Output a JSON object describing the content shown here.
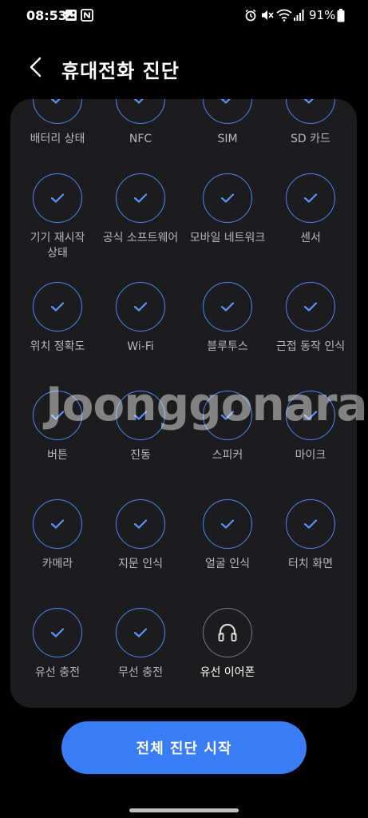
{
  "status_bar": {
    "time": "08:53",
    "battery": "91%",
    "icons": [
      "gallery-icon",
      "nfc-icon",
      "alarm-icon",
      "mute-icon",
      "wifi-icon",
      "signal-icon",
      "battery-icon"
    ]
  },
  "header": {
    "title": "휴대전화 진단",
    "back_icon": "chevron-left-icon"
  },
  "tests": [
    {
      "label": "배터리 상태",
      "status": "passed"
    },
    {
      "label": "NFC",
      "status": "passed"
    },
    {
      "label": "SIM",
      "status": "passed"
    },
    {
      "label": "SD 카드",
      "status": "passed"
    },
    {
      "label": "기기 재시작\n상태",
      "status": "passed"
    },
    {
      "label": "공식 소프트웨어",
      "status": "passed"
    },
    {
      "label": "모바일 네트워크",
      "status": "passed"
    },
    {
      "label": "센서",
      "status": "passed"
    },
    {
      "label": "위치 정확도",
      "status": "passed"
    },
    {
      "label": "Wi-Fi",
      "status": "passed"
    },
    {
      "label": "블루투스",
      "status": "passed"
    },
    {
      "label": "근접 동작 인식",
      "status": "passed"
    },
    {
      "label": "버튼",
      "status": "passed"
    },
    {
      "label": "진동",
      "status": "passed"
    },
    {
      "label": "스피커",
      "status": "passed"
    },
    {
      "label": "마이크",
      "status": "passed"
    },
    {
      "label": "카메라",
      "status": "passed"
    },
    {
      "label": "지문 인식",
      "status": "passed"
    },
    {
      "label": "얼굴 인식",
      "status": "passed"
    },
    {
      "label": "터치 화면",
      "status": "passed"
    },
    {
      "label": "유선 충전",
      "status": "passed"
    },
    {
      "label": "무선 충전",
      "status": "passed"
    },
    {
      "label": "유선 이어폰",
      "status": "pending",
      "icon": "headphones-icon"
    }
  ],
  "watermark": "Joonggonara",
  "start_button": "전체 진단 시작",
  "colors": {
    "accent": "#3a7cf6",
    "check": "#4d86f5",
    "card_bg": "#1c1c1e",
    "background": "#000000"
  }
}
